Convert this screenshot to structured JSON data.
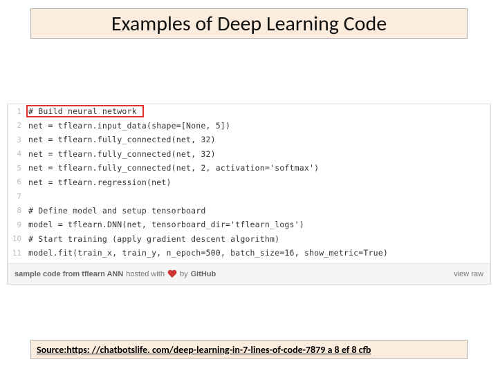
{
  "title": "Examples of Deep Learning Code",
  "code": {
    "lines": [
      "# Build neural network",
      "net = tflearn.input_data(shape=[None, 5])",
      "net = tflearn.fully_connected(net, 32)",
      "net = tflearn.fully_connected(net, 32)",
      "net = tflearn.fully_connected(net, 2, activation='softmax')",
      "net = tflearn.regression(net)",
      "",
      "# Define model and setup tensorboard",
      "model = tflearn.DNN(net, tensorboard_dir='tflearn_logs')",
      "# Start training (apply gradient descent algorithm)",
      "model.fit(train_x, train_y, n_epoch=500, batch_size=16, show_metric=True)"
    ],
    "line_numbers": [
      "1",
      "2",
      "3",
      "4",
      "5",
      "6",
      "7",
      "8",
      "9",
      "10",
      "11"
    ]
  },
  "gist_footer": {
    "filename": "sample code from tflearn ANN",
    "hosted_with": "hosted with",
    "by": "by",
    "host": "GitHub",
    "view_raw": "view raw"
  },
  "source": {
    "label": "Source: ",
    "url": "https: //chatbotslife. com/deep-learning-in-7-lines-of-code-7879 a 8 ef 8 cfb"
  }
}
